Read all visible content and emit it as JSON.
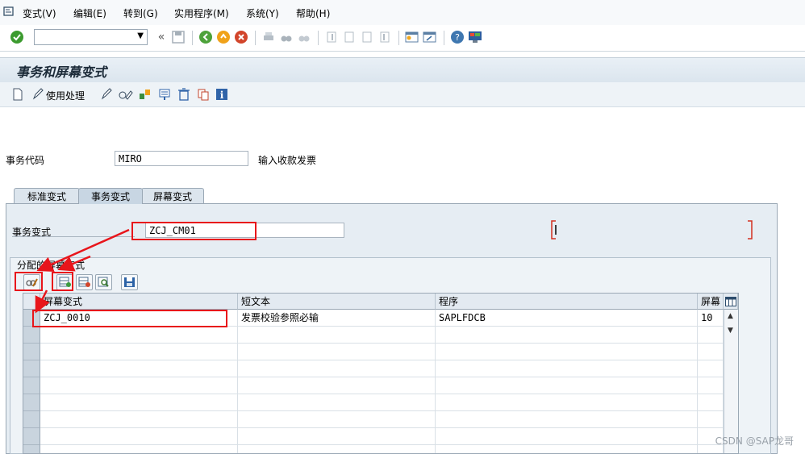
{
  "menu": [
    "变式(V)",
    "编辑(E)",
    "转到(G)",
    "实用程序(M)",
    "系统(Y)",
    "帮助(H)"
  ],
  "toolbar": {
    "command_value": ""
  },
  "title": "事务和屏幕变式",
  "app_toolbar": {
    "use_process_label": "使用处理"
  },
  "tcode": {
    "label": "事务代码",
    "value": "MIRO",
    "desc": "输入收款发票"
  },
  "tabs": [
    "标准变式",
    "事务变式",
    "屏幕变式"
  ],
  "tx_variant": {
    "label": "事务变式",
    "value": "ZCJ_CM01"
  },
  "group": {
    "title": "分配的屏幕变式"
  },
  "table": {
    "headers": [
      "屏幕变式",
      "短文本",
      "程序",
      "屏幕"
    ],
    "rows": [
      [
        "ZCJ_0010",
        "发票校验参照必输",
        "SAPLFDCB",
        "10"
      ]
    ]
  },
  "watermark": "CSDN @SAP龙哥",
  "colors": {
    "highlight": "#e8151b",
    "title_bg": "#dbe5ee",
    "panel_bg": "#e6edf3"
  }
}
